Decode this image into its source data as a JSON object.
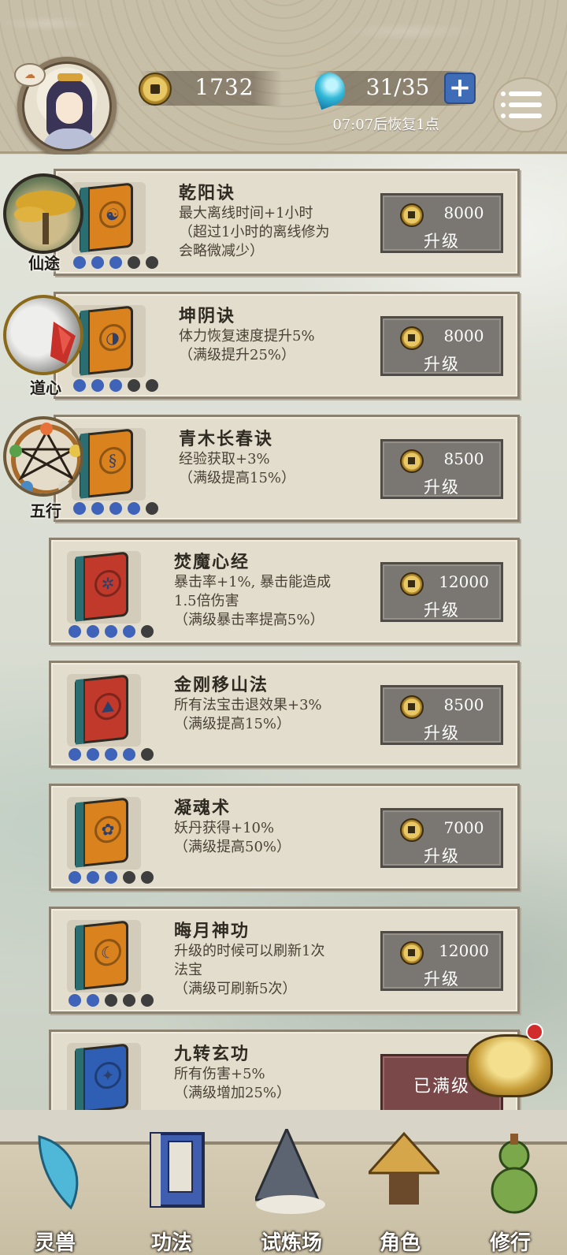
{
  "header": {
    "coins": "1732",
    "energy": "31/35",
    "recover_text": "07:07后恢复1点",
    "plus_label": "+"
  },
  "side_icons": [
    {
      "label": "仙途"
    },
    {
      "label": "道心"
    },
    {
      "label": "五行"
    }
  ],
  "upgrade_label": "升级",
  "maxed_label": "已满级",
  "skills": [
    {
      "name": "乾阳诀",
      "desc": "最大离线时间+1小时\n（超过1小时的离线修为\n会略微减少）",
      "price": "8000",
      "level": 3,
      "max": 5,
      "color": "#d9821e",
      "emblem": "☯"
    },
    {
      "name": "坤阴诀",
      "desc": "体力恢复速度提升5%\n（满级提升25%）",
      "price": "8000",
      "level": 3,
      "max": 5,
      "color": "#d9821e",
      "emblem": "◑"
    },
    {
      "name": "青木长春诀",
      "desc": "经验获取+3%\n（满级提高15%）",
      "price": "8500",
      "level": 4,
      "max": 5,
      "color": "#d9821e",
      "emblem": "§"
    },
    {
      "name": "焚魔心经",
      "desc": "暴击率+1%, 暴击能造成\n1.5倍伤害\n（满级暴击率提高5%）",
      "price": "12000",
      "level": 4,
      "max": 5,
      "color": "#c0392b",
      "emblem": "✲"
    },
    {
      "name": "金刚移山法",
      "desc": "所有法宝击退效果+3%\n（满级提高15%）",
      "price": "8500",
      "level": 4,
      "max": 5,
      "color": "#c0392b",
      "emblem": "⛰"
    },
    {
      "name": "凝魂术",
      "desc": "妖丹获得+10%\n（满级提高50%）",
      "price": "7000",
      "level": 3,
      "max": 5,
      "color": "#d9821e",
      "emblem": "✿"
    },
    {
      "name": "晦月神功",
      "desc": "升级的时候可以刷新1次\n法宝\n（满级可刷新5次）",
      "price": "12000",
      "level": 2,
      "max": 5,
      "color": "#d9821e",
      "emblem": "☾"
    },
    {
      "name": "九转玄功",
      "desc": "所有伤害+5%\n（满级增加25%）",
      "price": "",
      "level": 5,
      "max": 5,
      "color": "#2f5fb5",
      "emblem": "✦",
      "maxed": true
    }
  ],
  "nav": [
    {
      "label": "灵兽",
      "icon": "feather-icon"
    },
    {
      "label": "功法",
      "icon": "book-icon"
    },
    {
      "label": "试炼场",
      "icon": "mountain-icon"
    },
    {
      "label": "角色",
      "icon": "straw-hat-icon"
    },
    {
      "label": "修行",
      "icon": "gourd-icon"
    }
  ],
  "colors": {
    "accent_blue": "#3f63b8",
    "button_gray": "#7a7671",
    "maxed_red": "#7a4848"
  }
}
